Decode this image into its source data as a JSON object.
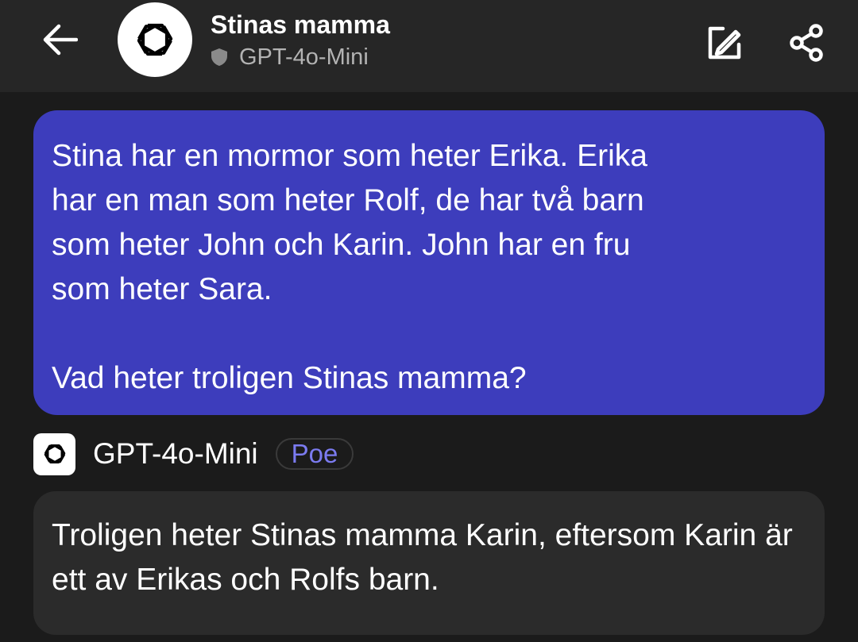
{
  "header": {
    "title": "Stinas mamma",
    "bot_subtitle": "GPT-4o-Mini",
    "icons": {
      "back": "arrow-left-icon",
      "avatar": "openai-logo-icon",
      "shield": "shield-icon",
      "edit": "edit-icon",
      "share": "share-icon"
    }
  },
  "messages": {
    "user": {
      "text": "Stina har en mormor som heter Erika. Erika\nhar en man som heter Rolf, de har två barn\nsom heter John och Karin. John har en fru\nsom heter Sara.\n\nVad heter troligen Stinas mamma?"
    },
    "bot": {
      "name": "GPT-4o-Mini",
      "badge": "Poe",
      "text": "Troligen heter Stinas mamma Karin, eftersom Karin är ett av Erikas och Rolfs barn."
    }
  },
  "colors": {
    "background": "#1b1b1b",
    "header": "#262626",
    "user_bubble": "#3d3dbc",
    "bot_bubble": "#2b2b2b",
    "badge_text": "#7b7bf0"
  }
}
